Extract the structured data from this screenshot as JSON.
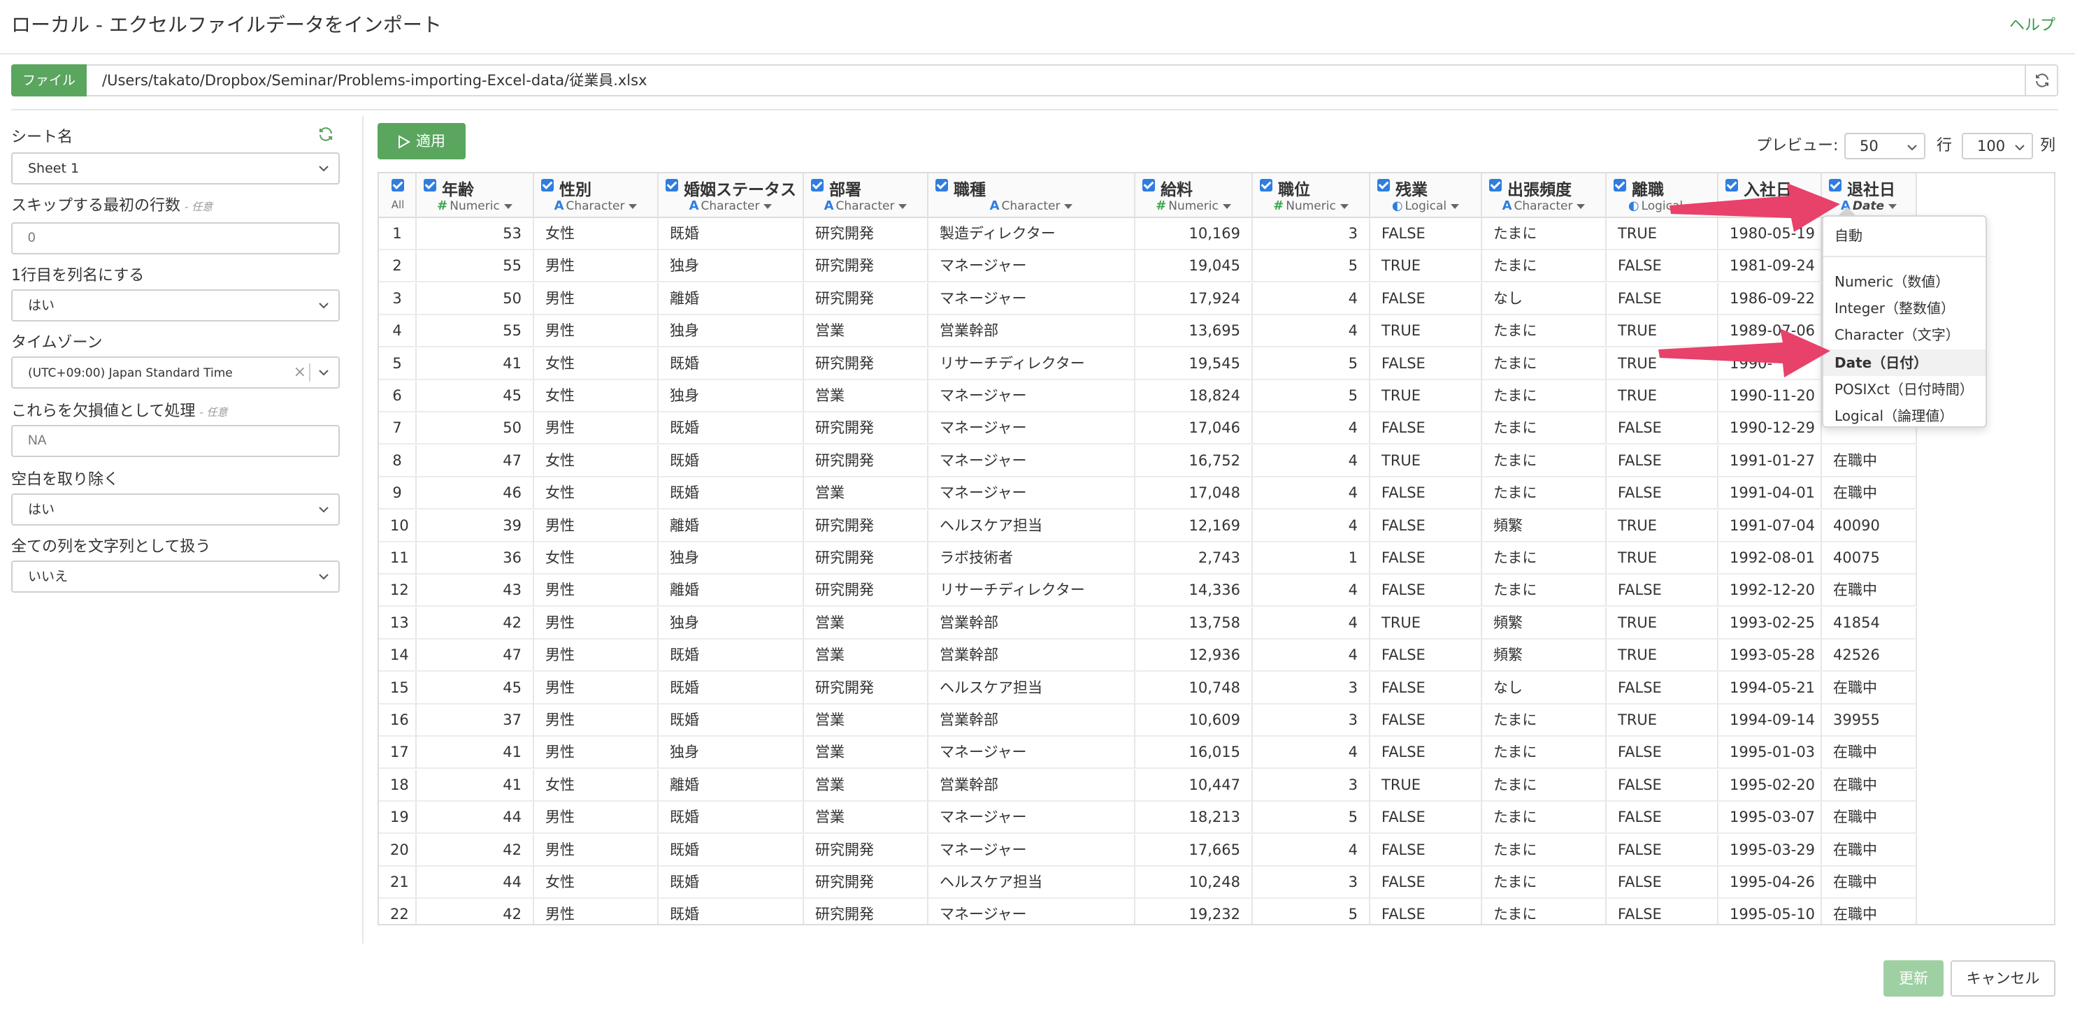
{
  "header": {
    "title": "ローカル - エクセルファイルデータをインポート",
    "help": "ヘルプ"
  },
  "file": {
    "button": "ファイル",
    "path": "/Users/takato/Dropbox/Seminar/Problems-importing-Excel-data/従業員.xlsx"
  },
  "left_panel": {
    "sheet_label": "シート名",
    "sheet_value": "Sheet 1",
    "skip_label": "スキップする最初の行数",
    "optional": "- 任意",
    "skip_placeholder": "0",
    "header_label": "1行目を列名にする",
    "header_value": "はい",
    "tz_label": "タイムゾーン",
    "tz_value": "(UTC+09:00) Japan Standard Time",
    "tz_clear": "×",
    "na_label": "これらを欠損値として処理",
    "na_placeholder": "NA",
    "trim_label": "空白を取り除く",
    "trim_value": "はい",
    "char_label": "全ての列を文字列として扱う",
    "char_value": "いいえ"
  },
  "toolbar": {
    "apply": "適用",
    "preview_label": "プレビュー:",
    "preview_rows": "50",
    "rows_unit": "行",
    "preview_cols": "100",
    "cols_unit": "列"
  },
  "table": {
    "all_label": "All",
    "columns": [
      {
        "name": "年齢",
        "type": "Numeric",
        "glyph": "#"
      },
      {
        "name": "性別",
        "type": "Character",
        "glyph": "A"
      },
      {
        "name": "婚姻ステータス",
        "type": "Character",
        "glyph": "A"
      },
      {
        "name": "部署",
        "type": "Character",
        "glyph": "A"
      },
      {
        "name": "職種",
        "type": "Character",
        "glyph": "A"
      },
      {
        "name": "給料",
        "type": "Numeric",
        "glyph": "#"
      },
      {
        "name": "職位",
        "type": "Numeric",
        "glyph": "#"
      },
      {
        "name": "残業",
        "type": "Logical",
        "glyph": "◐"
      },
      {
        "name": "出張頻度",
        "type": "Character",
        "glyph": "A"
      },
      {
        "name": "離職",
        "type": "Logical",
        "glyph": "◐"
      },
      {
        "name": "入社日",
        "type": "",
        "glyph": ""
      },
      {
        "name": "退社日",
        "type": "Date",
        "glyph": "A"
      }
    ],
    "rows": [
      [
        "1",
        "53",
        "女性",
        "既婚",
        "研究開発",
        "製造ディレクター",
        "10,169",
        "3",
        "FALSE",
        "たまに",
        "TRUE",
        "1980-05-19",
        ""
      ],
      [
        "2",
        "55",
        "男性",
        "独身",
        "研究開発",
        "マネージャー",
        "19,045",
        "5",
        "TRUE",
        "たまに",
        "FALSE",
        "1981-09-24",
        ""
      ],
      [
        "3",
        "50",
        "男性",
        "離婚",
        "研究開発",
        "マネージャー",
        "17,924",
        "4",
        "FALSE",
        "なし",
        "FALSE",
        "1986-09-22",
        ""
      ],
      [
        "4",
        "55",
        "男性",
        "独身",
        "営業",
        "営業幹部",
        "13,695",
        "4",
        "TRUE",
        "たまに",
        "TRUE",
        "1989-07-06",
        ""
      ],
      [
        "5",
        "41",
        "女性",
        "既婚",
        "研究開発",
        "リサーチディレクター",
        "19,545",
        "5",
        "FALSE",
        "たまに",
        "TRUE",
        "1990-",
        "",
        ""
      ],
      [
        "6",
        "45",
        "女性",
        "独身",
        "営業",
        "マネージャー",
        "18,824",
        "5",
        "TRUE",
        "たまに",
        "TRUE",
        "1990-11-20",
        ""
      ],
      [
        "7",
        "50",
        "男性",
        "既婚",
        "研究開発",
        "マネージャー",
        "17,046",
        "4",
        "FALSE",
        "たまに",
        "FALSE",
        "1990-12-29",
        ""
      ],
      [
        "8",
        "47",
        "女性",
        "既婚",
        "研究開発",
        "マネージャー",
        "16,752",
        "4",
        "TRUE",
        "たまに",
        "FALSE",
        "1991-01-27",
        "在職中"
      ],
      [
        "9",
        "46",
        "女性",
        "既婚",
        "営業",
        "マネージャー",
        "17,048",
        "4",
        "FALSE",
        "たまに",
        "FALSE",
        "1991-04-01",
        "在職中"
      ],
      [
        "10",
        "39",
        "男性",
        "離婚",
        "研究開発",
        "ヘルスケア担当",
        "12,169",
        "4",
        "FALSE",
        "頻繁",
        "TRUE",
        "1991-07-04",
        "40090"
      ],
      [
        "11",
        "36",
        "女性",
        "独身",
        "研究開発",
        "ラボ技術者",
        "2,743",
        "1",
        "FALSE",
        "たまに",
        "TRUE",
        "1992-08-01",
        "40075"
      ],
      [
        "12",
        "43",
        "男性",
        "離婚",
        "研究開発",
        "リサーチディレクター",
        "14,336",
        "4",
        "FALSE",
        "たまに",
        "FALSE",
        "1992-12-20",
        "在職中"
      ],
      [
        "13",
        "42",
        "男性",
        "独身",
        "営業",
        "営業幹部",
        "13,758",
        "4",
        "TRUE",
        "頻繁",
        "TRUE",
        "1993-02-25",
        "41854"
      ],
      [
        "14",
        "47",
        "男性",
        "既婚",
        "営業",
        "営業幹部",
        "12,936",
        "4",
        "FALSE",
        "頻繁",
        "TRUE",
        "1993-05-28",
        "42526"
      ],
      [
        "15",
        "45",
        "男性",
        "既婚",
        "研究開発",
        "ヘルスケア担当",
        "10,748",
        "3",
        "FALSE",
        "なし",
        "FALSE",
        "1994-05-21",
        "在職中"
      ],
      [
        "16",
        "37",
        "男性",
        "既婚",
        "営業",
        "営業幹部",
        "10,609",
        "3",
        "FALSE",
        "たまに",
        "TRUE",
        "1994-09-14",
        "39955"
      ],
      [
        "17",
        "41",
        "男性",
        "独身",
        "営業",
        "マネージャー",
        "16,015",
        "4",
        "FALSE",
        "たまに",
        "FALSE",
        "1995-01-03",
        "在職中"
      ],
      [
        "18",
        "41",
        "女性",
        "離婚",
        "営業",
        "営業幹部",
        "10,447",
        "3",
        "TRUE",
        "たまに",
        "FALSE",
        "1995-02-20",
        "在職中"
      ],
      [
        "19",
        "44",
        "男性",
        "既婚",
        "営業",
        "マネージャー",
        "18,213",
        "5",
        "FALSE",
        "たまに",
        "FALSE",
        "1995-03-07",
        "在職中"
      ],
      [
        "20",
        "42",
        "男性",
        "既婚",
        "研究開発",
        "マネージャー",
        "17,665",
        "4",
        "FALSE",
        "たまに",
        "FALSE",
        "1995-03-29",
        "在職中"
      ],
      [
        "21",
        "44",
        "女性",
        "既婚",
        "研究開発",
        "ヘルスケア担当",
        "10,248",
        "3",
        "FALSE",
        "たまに",
        "FALSE",
        "1995-04-26",
        "在職中"
      ],
      [
        "22",
        "42",
        "男性",
        "既婚",
        "研究開発",
        "マネージャー",
        "19,232",
        "5",
        "FALSE",
        "たまに",
        "FALSE",
        "1995-05-10",
        "在職中"
      ]
    ]
  },
  "type_menu": {
    "items": [
      "自動",
      "Numeric（数値）",
      "Integer（整数値）",
      "Character（文字）",
      "Date（日付）",
      "POSIXct（日付時間）",
      "Logical（論理値）"
    ],
    "selected": "Date（日付）"
  },
  "colors": {
    "accent": "#5aa65f",
    "checkbox": "#2f7de0",
    "arrow": "#e8416a"
  },
  "footer": {
    "update": "更新",
    "cancel": "キャンセル"
  }
}
